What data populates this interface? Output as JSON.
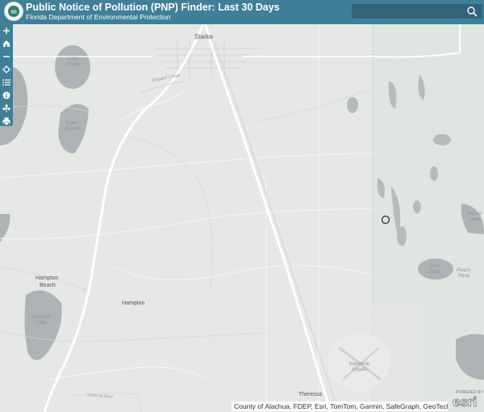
{
  "header": {
    "title": "Public Notice of Pollution (PNP) Finder: Last 30 Days",
    "subtitle": "Florida Department of Environmental Protection",
    "logo_icon": "fdep-seal-logo"
  },
  "search": {
    "placeholder": "",
    "icon": "search-icon"
  },
  "toolbar": {
    "tools": [
      "zoom-in",
      "home",
      "zoom-out",
      "locate",
      "layer-list",
      "legend-info",
      "basemap",
      "print"
    ]
  },
  "map": {
    "labels": {
      "starke": "Starke",
      "lake_crosby": "Lake\nCrosby",
      "lake_rowell": "Lake\nRowell",
      "alligator_creek": "Alligator Creek",
      "hampton_beach": "Hampton\nBeach",
      "hampton_lake": "Hampton\nLake",
      "hampton": "Hampton",
      "keystone_airpark": "Keystone\nAirpark",
      "theressa": "Theressa",
      "santa_fe_river": "Santa Fe River",
      "blue_pond": "Blue\nPond",
      "peach_pond": "Peach\nPond",
      "steven_lake": "Steven\nLake"
    }
  },
  "attribution": "County of Alachua, FDEP, Esri, TomTom, Garmin, SafeGraph, GeoTechnologi...",
  "branding": {
    "powered_by": "POWERED BY",
    "wordmark": "esri"
  },
  "colors": {
    "header": "#3f7f98",
    "search_bg": "#2f6479",
    "water": "#a9b0b2",
    "land": "#e6e8e6",
    "park": "#dfe6e2"
  }
}
